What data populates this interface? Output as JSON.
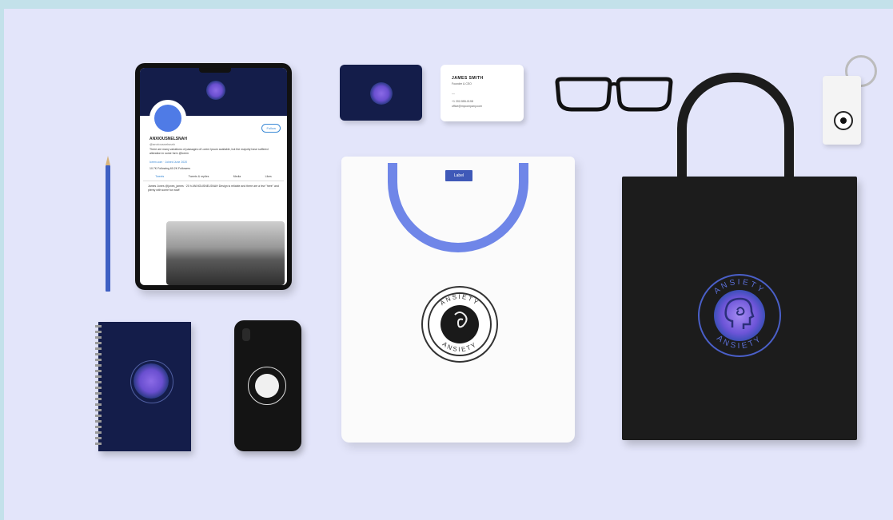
{
  "tablet": {
    "profile_name": "ANXIOUSNELSNAH",
    "handle": "@anxiousnelsnah",
    "follow_label": "Follow",
    "bio": "There are many variations of passages of Lorem Ipsum available, but the majority have suffered alteration in some form @lorem",
    "link": "lorem.com",
    "joined": "Joined June 2020",
    "stats": "10.7K Following  60.2K Followers",
    "tabs": [
      "Tweets",
      "Tweets & replies",
      "Media",
      "Likes"
    ],
    "tweet": "James Jones @jones_james · 20 h  ANXIOUSNELSNAH Design is reliable and there are a few \"here\" and plenty with some fun stuff"
  },
  "business_card": {
    "name": "JAMES SMITH",
    "role": "Founder & CEO",
    "dash": "—",
    "phone": "+1 202-555-0198",
    "email": "office@mycompany.com"
  },
  "tshirt": {
    "label": "Label",
    "logo_text_top": "ANSIETY",
    "logo_text_bottom": "ANSIETY"
  },
  "tote": {
    "logo_text_top": "ANSIETY",
    "logo_text_bottom": "ANSIETY"
  },
  "colors": {
    "background": "#e3e5fa",
    "border": "#c3e1ea",
    "navy": "#141d4a",
    "collar": "#6f86e8",
    "purple": "#8b6ae6",
    "black": "#1c1c1c"
  }
}
